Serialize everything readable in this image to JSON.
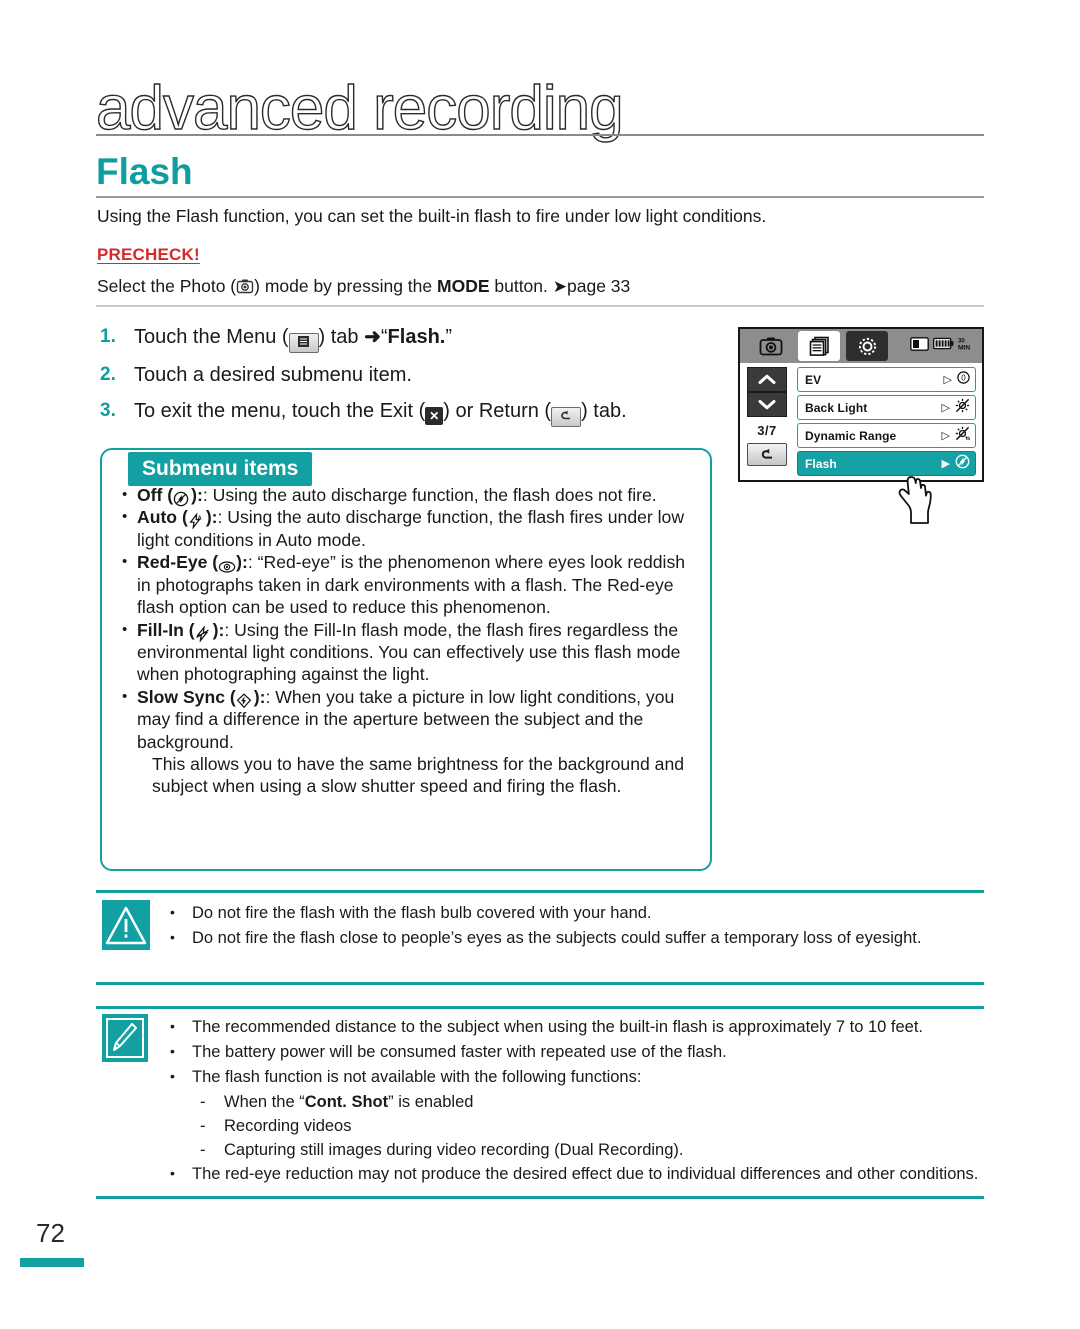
{
  "header": {
    "chapter": "advanced recording",
    "section": "Flash",
    "intro": "Using the Flash function, you can set the built-in flash to fire under low light conditions.",
    "precheck_label": "PRECHECK!",
    "precheck_prefix": "Select the Photo (",
    "precheck_mid": ") mode by pressing the ",
    "precheck_mode": "MODE",
    "precheck_suffix": " button. ",
    "precheck_page": "page 33"
  },
  "steps": [
    {
      "num": "1.",
      "a": "Touch the Menu (",
      "b": ") tab ",
      "arrow": "➜",
      "c": "“",
      "bold": "Flash.",
      "d": "”"
    },
    {
      "num": "2.",
      "a": "Touch a desired submenu item."
    },
    {
      "num": "3.",
      "a": "To exit the menu, touch the Exit (",
      "b": ") or Return (",
      "c": ") tab."
    }
  ],
  "submenu": {
    "heading": "Submenu items",
    "items": [
      {
        "name": "Off",
        "icon": "flash-off-icon",
        "text": ": Using the auto discharge function, the flash does not fire."
      },
      {
        "name": "Auto",
        "icon": "flash-auto-icon",
        "text": ": Using the auto discharge function, the flash fires under low light conditions in Auto mode."
      },
      {
        "name": "Red-Eye",
        "icon": "red-eye-icon",
        "text": ": “Red-eye” is the phenomenon where eyes look reddish in photographs taken in dark environments with a flash. The Red-eye flash option can be used to reduce this phenomenon."
      },
      {
        "name": "Fill-In",
        "icon": "fill-in-flash-icon",
        "text": ": Using the Fill-In flash mode, the flash fires regardless the environmental light conditions. You can effectively use this flash mode when photographing against the light."
      },
      {
        "name": "Slow Sync",
        "icon": "slow-sync-icon",
        "text": ": When you take a picture in low light conditions, you may find a difference in the aperture between the subject and the background.",
        "extra": "This allows you to have the same brightness for the background and subject when using a slow shutter speed and firing the flash."
      }
    ]
  },
  "caution": {
    "icon": "warning-triangle-icon",
    "bullets": [
      "Do not fire the flash with the flash bulb covered with your hand.",
      "Do not fire the flash close to people’s eyes as the subjects could suffer a temporary loss of eyesight."
    ]
  },
  "note": {
    "icon": "note-pencil-icon",
    "bullets": [
      {
        "text": "The recommended distance to the subject when using the built-in flash is approximately 7 to 10 feet."
      },
      {
        "text": "The battery power will be consumed faster with repeated use of the flash."
      },
      {
        "text": "The flash function is not available with the following functions:",
        "sub": [
          {
            "pre": "When the “",
            "bold": "Cont. Shot",
            "post": "” is enabled"
          },
          {
            "pre": "Recording videos",
            "bold": "",
            "post": ""
          },
          {
            "pre": "Capturing still images during video recording (Dual Recording).",
            "bold": "",
            "post": ""
          }
        ]
      },
      {
        "text": "The red-eye reduction may not produce the desired effect due to individual differences and other conditions."
      }
    ]
  },
  "lcd": {
    "tabs": [
      {
        "name": "photo-mode-tab",
        "icon": "camera-icon"
      },
      {
        "name": "menu-tab",
        "icon": "menu-pages-icon"
      },
      {
        "name": "settings-tab",
        "icon": "gear-icon"
      }
    ],
    "status": [
      {
        "name": "sd-card-icon"
      },
      {
        "name": "battery-icon"
      },
      {
        "name": "record-time-icon",
        "label": "30 MIN"
      }
    ],
    "nav": {
      "up": "up-chevron",
      "down": "down-chevron",
      "page_indicator": "3/7",
      "return": "return-arrow"
    },
    "rows": [
      {
        "label": "EV",
        "value": "0",
        "value_type": "text"
      },
      {
        "label": "Back Light",
        "value": "",
        "value_type": "backlight-off-icon"
      },
      {
        "label": "Dynamic Range",
        "value": "",
        "value_type": "dynamic-range-off-icon"
      },
      {
        "label": "Flash",
        "value": "",
        "value_type": "flash-off-icon",
        "active": true
      }
    ]
  },
  "footer": {
    "page_number": "72"
  },
  "colors": {
    "teal": "#13a0a3",
    "red": "#d42a2a"
  }
}
